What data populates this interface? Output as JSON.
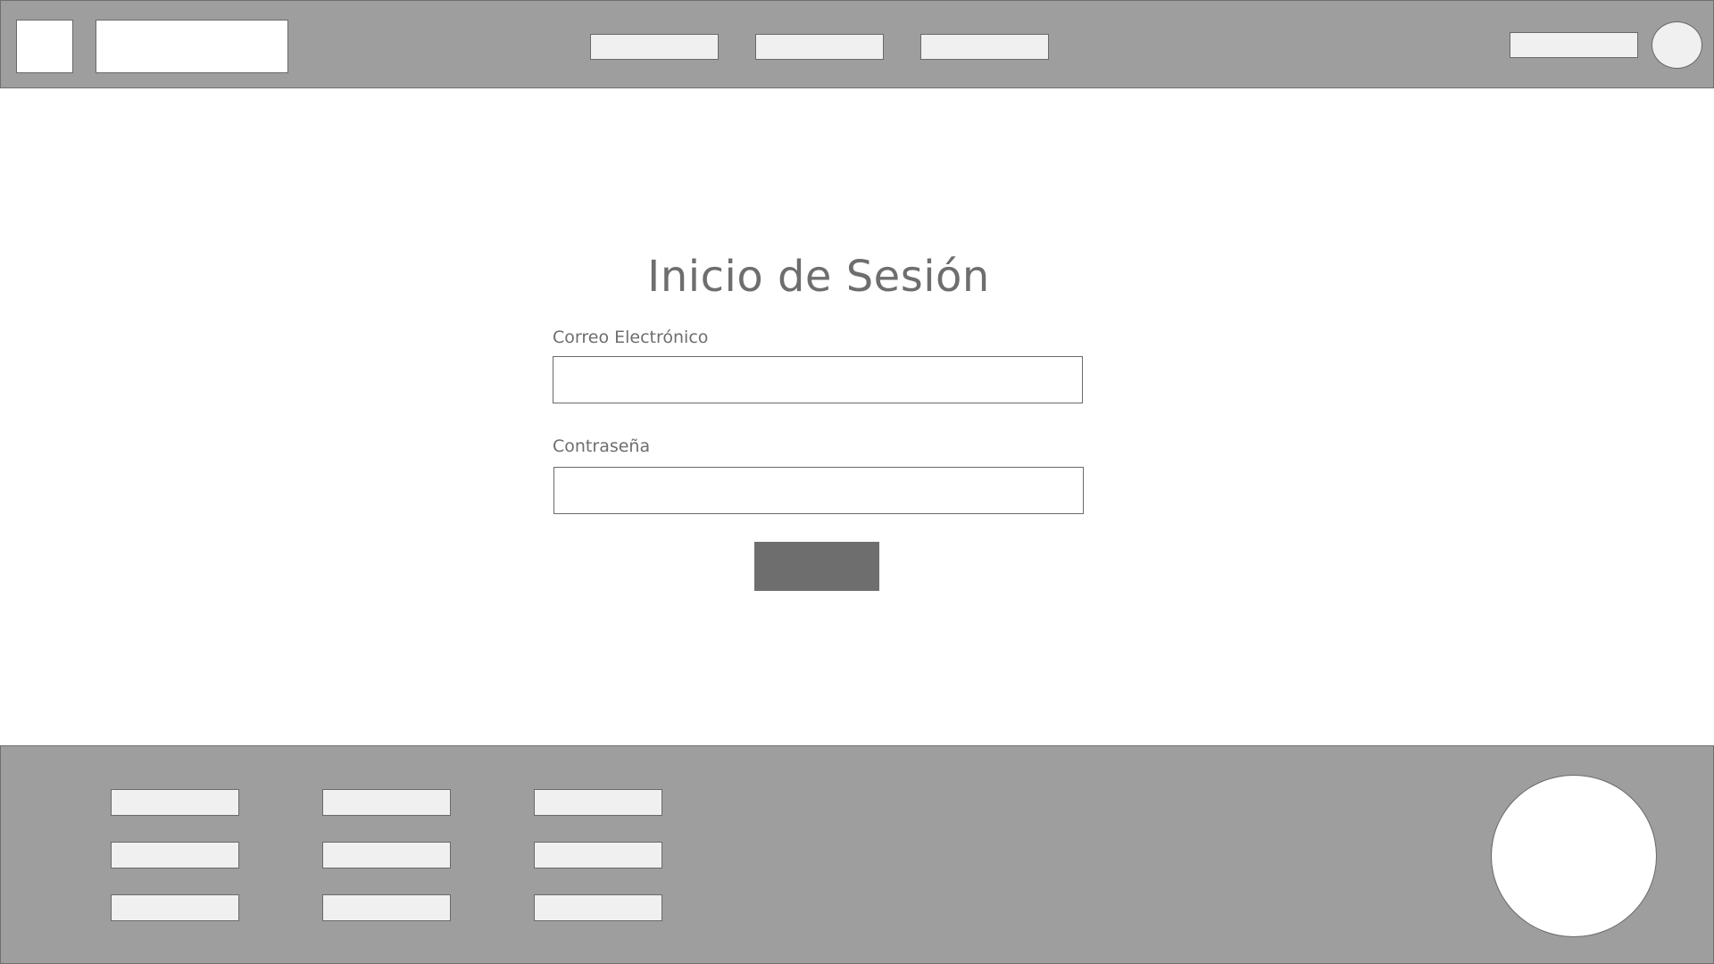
{
  "header": {
    "nav_items": [
      "",
      "",
      ""
    ],
    "search_value": ""
  },
  "login": {
    "title": "Inicio de Sesión",
    "email_label": "Correo Electrónico",
    "email_value": "",
    "password_label": "Contraseña",
    "password_value": "",
    "submit_label": ""
  },
  "footer": {
    "links": [
      [
        "",
        "",
        ""
      ],
      [
        "",
        "",
        ""
      ],
      [
        "",
        "",
        ""
      ]
    ]
  },
  "colors": {
    "bar_background": "#9e9e9e",
    "placeholder_box": "#f0f0f0",
    "primary_button": "#6e6e6e",
    "text": "#6e6e6e"
  }
}
